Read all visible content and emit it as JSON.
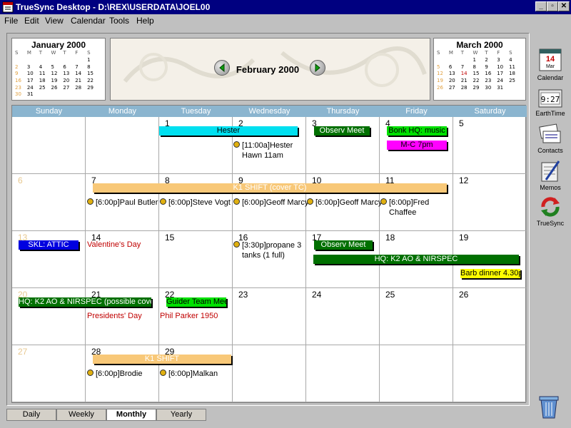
{
  "app": {
    "title": "TrueSync Desktop - D:\\REX\\USERDATA\\JOEL00"
  },
  "window_controls": {
    "minimize": "_",
    "restore": "▫",
    "close": "✕"
  },
  "menu": [
    "File",
    "Edit",
    "View",
    "Calendar",
    "Tools",
    "Help"
  ],
  "mini_prev": {
    "title": "January 2000",
    "days": [
      "S",
      "M",
      "T",
      "W",
      "T",
      "F",
      "S"
    ],
    "dates": [
      "",
      "",
      "",
      "",
      "",
      "",
      "1",
      "2",
      "3",
      "4",
      "5",
      "6",
      "7",
      "8",
      "9",
      "10",
      "11",
      "12",
      "13",
      "14",
      "15",
      "16",
      "17",
      "18",
      "19",
      "20",
      "21",
      "22",
      "23",
      "24",
      "25",
      "26",
      "27",
      "28",
      "29",
      "30",
      "31"
    ]
  },
  "mini_next": {
    "title": "March 2000",
    "days": [
      "S",
      "M",
      "T",
      "W",
      "T",
      "F",
      "S"
    ],
    "dates": [
      "",
      "",
      "",
      "1",
      "2",
      "3",
      "4",
      "5",
      "6",
      "7",
      "8",
      "9",
      "10",
      "11",
      "12",
      "13",
      "14",
      "15",
      "16",
      "17",
      "18",
      "19",
      "20",
      "21",
      "22",
      "23",
      "24",
      "25",
      "26",
      "27",
      "28",
      "29",
      "30",
      "31"
    ]
  },
  "banner": {
    "month_title": "February 2000"
  },
  "day_headers": [
    "Sunday",
    "Monday",
    "Tuesday",
    "Wednesday",
    "Thursday",
    "Friday",
    "Saturday"
  ],
  "weeks": [
    [
      "",
      "",
      "1",
      "2",
      "3",
      "4",
      "5"
    ],
    [
      "6",
      "7",
      "8",
      "9",
      "10",
      "11",
      "12"
    ],
    [
      "13",
      "14",
      "15",
      "16",
      "17",
      "18",
      "19"
    ],
    [
      "20",
      "21",
      "22",
      "23",
      "24",
      "25",
      "26"
    ],
    [
      "27",
      "28",
      "29",
      "",
      "",
      "",
      ""
    ]
  ],
  "events": {
    "hester": "Hester",
    "observ_meet_1": "Observ Meet",
    "bonk": "Bonk HQ: music",
    "mc": "M-C 7pm",
    "k1_shift_covers": "K1 SHIFT (cover TC)",
    "skl_attic": "SKL: ATTIC",
    "observ_meet_2": "Observ Meet",
    "hq_k2_ao": "HQ: K2 AO & NIRSPEC",
    "barb_dinner": "Barb dinner 4.30p",
    "hq_k2_ao_possible": "HQ: K2 AO & NIRSPEC (possible cover",
    "guider_team": "Guider Team Meet",
    "k1_shift": "K1 SHIFT"
  },
  "appointments": {
    "hester_hawn": "[11:00a]Hester Hawn 11am",
    "paul_butler": "[6:00p]Paul Butler",
    "steve_vogt": "[6:00p]Steve Vogt",
    "geoff_marcy_1": "[6:00p]Geoff Marcy",
    "geoff_marcy_2": "[6:00p]Geoff Marcy",
    "fred_chaffee": "[6:00p]Fred Chaffee",
    "propane": "[3:30p]propane 3 tanks (1 full)",
    "brodie": "[6:00p]Brodie",
    "malkan": "[6:00p]Malkan"
  },
  "holidays": {
    "valentines": "Valentine's Day",
    "presidents": "Presidents' Day",
    "phil_parker": "Phil Parker 1950"
  },
  "tools": {
    "calendar_icon_month": "Mar",
    "calendar_icon_day": "14",
    "calendar": "Calendar",
    "earthtime_clock": "9:27",
    "earthtime": "EarthTime",
    "contacts": "Contacts",
    "memos": "Memos",
    "truesync": "TrueSync"
  },
  "tabs": [
    "Daily",
    "Weekly",
    "Monthly",
    "Yearly"
  ],
  "active_tab": "Monthly",
  "colors": {
    "header_blue": "#8bb5cf",
    "cyan_event": "#00e0f0",
    "green_event": "#007000",
    "bright_green_event": "#00e000",
    "magenta_event": "#ff00ff",
    "orange_event": "#f8c878",
    "blue_event": "#0000e0",
    "yellow_event": "#ffff00",
    "holiday_red": "#c00000"
  }
}
